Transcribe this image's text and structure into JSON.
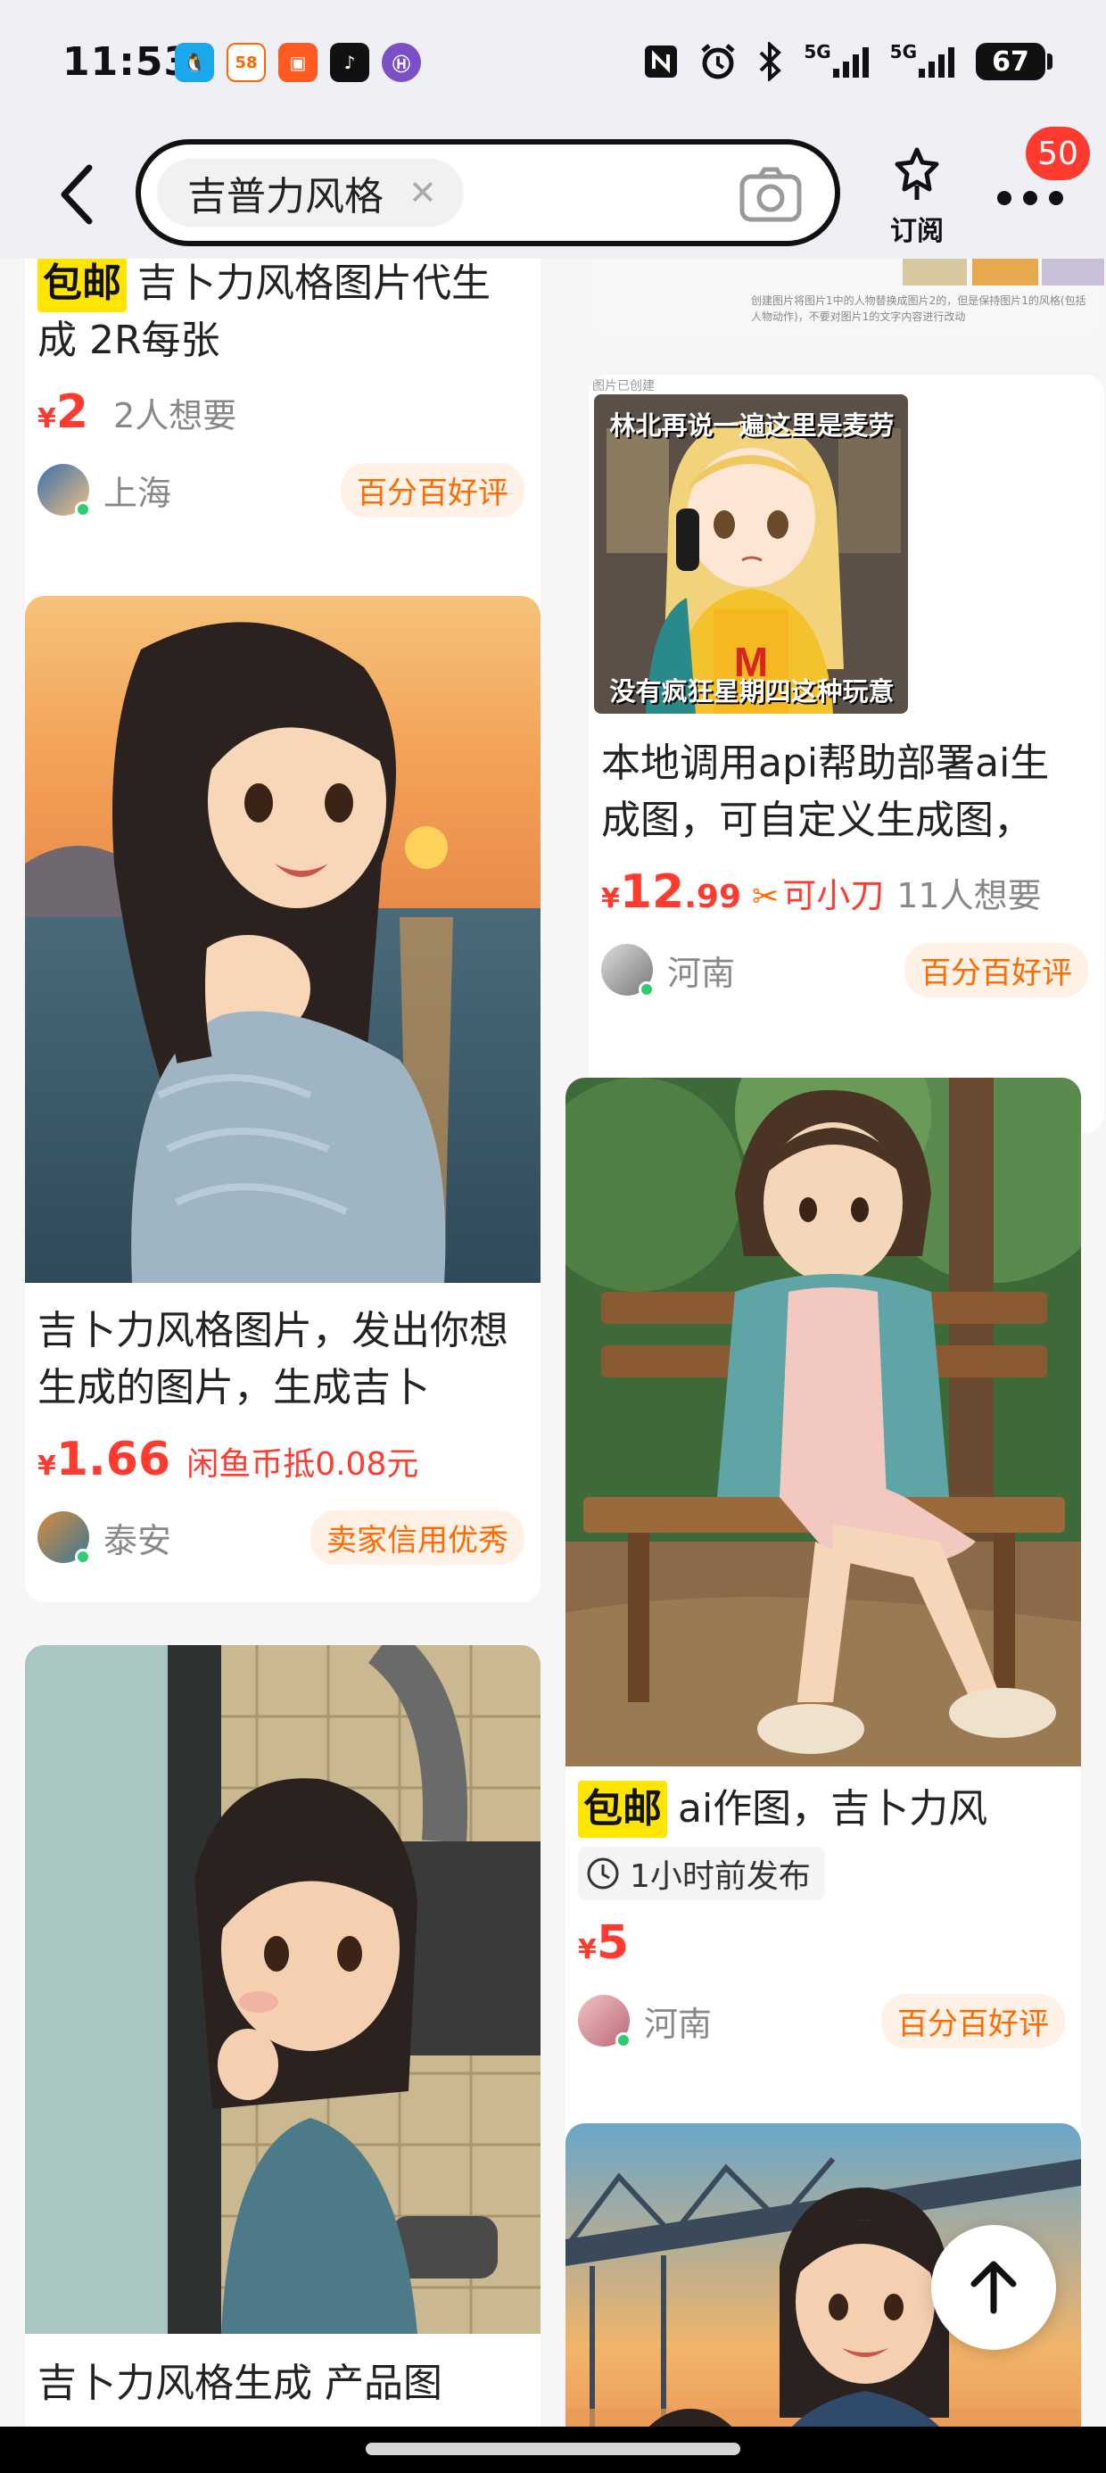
{
  "status_bar": {
    "time": "11:53",
    "notification_apps": [
      "QQ",
      "58",
      "快手",
      "抖音",
      "H"
    ],
    "signal_labels": [
      "5G",
      "5G"
    ],
    "battery": "67"
  },
  "header": {
    "search_text": "吉普力风格",
    "subscribe_label": "订阅",
    "more_badge": "50"
  },
  "cards": {
    "c1": {
      "free_shipping": "包邮",
      "title": "吉卜力风格图片代生成 2R每张",
      "currency": "¥",
      "price": "2",
      "wants": "2人想要",
      "location": "上海",
      "badge": "百分百好评"
    },
    "c2": {
      "image_caption": "创建图片将图片1中的人物替换成图片2的，但是保持图片1的风格(包括人物动作)，不要对图片1的文字内容进行改动"
    },
    "c3": {
      "image_top_label": "图片已创建",
      "meme_top": "林北再说一遍这里是麦劳",
      "meme_bottom": "没有疯狂星期四这种玩意",
      "title": "本地调用api帮助部署ai生成图，可自定义生成图，",
      "currency": "¥",
      "price": "12",
      "price_decimal": ".99",
      "promo": "可小刀",
      "wants": "11人想要",
      "location": "河南",
      "badge": "百分百好评"
    },
    "c4": {
      "title": "吉卜力风格图片，发出你想生成的图片，生成吉卜",
      "currency": "¥",
      "price": "1.66",
      "promo": "闲鱼币抵0.08元",
      "location": "泰安",
      "badge": "卖家信用优秀"
    },
    "c5": {
      "free_shipping": "包邮",
      "title": "ai作图，吉卜力风",
      "time_tag": "1小时前发布",
      "currency": "¥",
      "price": "5",
      "location": "河南",
      "badge": "百分百好评"
    },
    "c6": {
      "title": "吉卜力风格生成 产品图"
    }
  },
  "icons": [
    "back-icon",
    "clear-icon",
    "camera-icon",
    "subscribe-pin-icon",
    "more-icon",
    "clock-icon",
    "arrow-up-icon"
  ],
  "colors": {
    "price_red": "#ff3b30",
    "badge_orange": "#ff6a00",
    "free_ship_yellow": "#ffe500",
    "online_green": "#2ecc71"
  }
}
